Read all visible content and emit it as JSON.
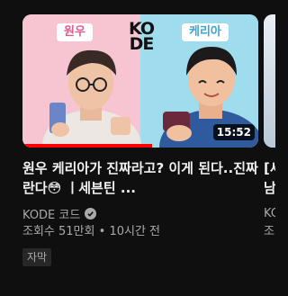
{
  "video": {
    "thumbnail": {
      "left_name": "원우",
      "right_name": "케리아",
      "logo_top": "KO",
      "logo_bottom": "DE",
      "duration": "15:52",
      "watch_progress": 0.55,
      "colors": {
        "left_bg": "#f7c4d2",
        "right_bg": "#9fdced",
        "progress": "#ff0000"
      }
    },
    "title": "원우 케리아가 진짜라고? 이게 된다..진짜란다😳 ㅣ세븐틴 ...",
    "channel": "KODE 코드",
    "verified_icon": "verified-check-icon",
    "views": "조회수 51만회",
    "separator": "•",
    "age": "10시간 전",
    "badge": "자막"
  },
  "next_video": {
    "title_start": "[세",
    "title_line2": "남",
    "channel_start": "KO",
    "meta_start": "조회"
  }
}
